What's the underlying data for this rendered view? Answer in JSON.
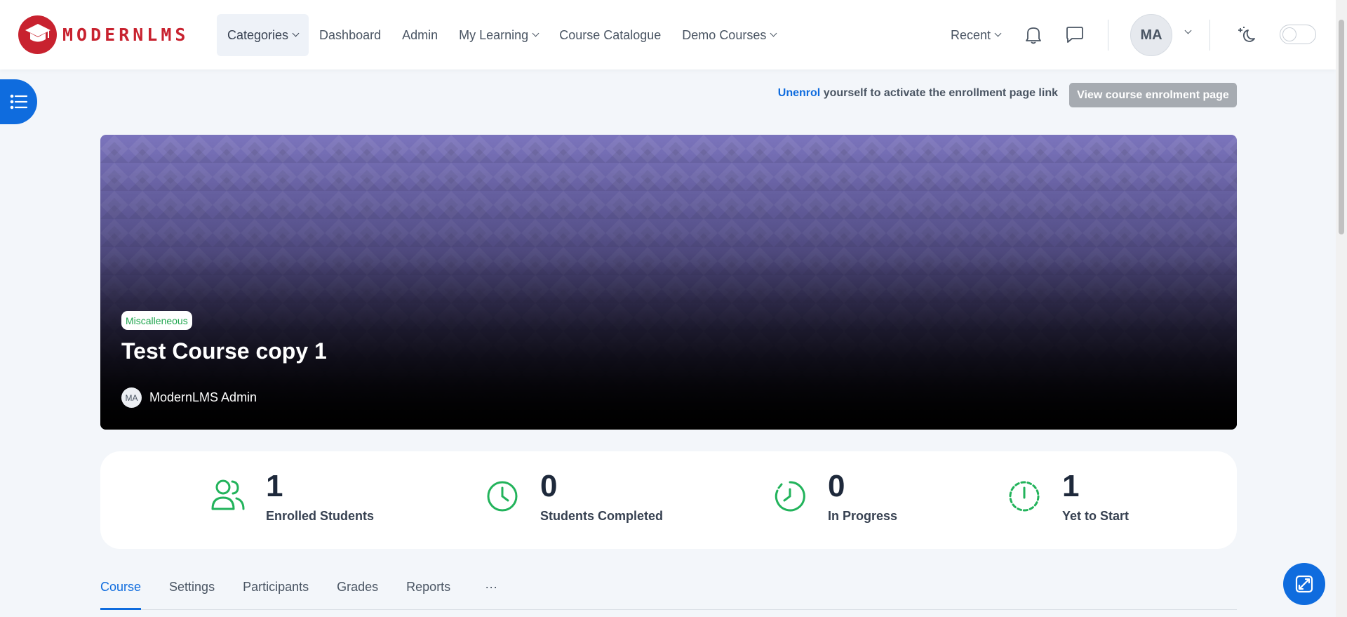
{
  "brand": {
    "name": "MODERNLMS",
    "color": "#c8222f"
  },
  "nav": {
    "categories": "Categories",
    "dashboard": "Dashboard",
    "admin": "Admin",
    "my_learning": "My Learning",
    "course_catalogue": "Course Catalogue",
    "demo_courses": "Demo Courses",
    "recent": "Recent",
    "user_initials": "MA"
  },
  "enrol": {
    "link_text": "Unenrol",
    "message": "yourself to activate the enrollment page link",
    "button": "View course enrolment page"
  },
  "course": {
    "category": "Miscalleneous",
    "title": "Test Course copy 1",
    "author_initials": "MA",
    "author_name": "ModernLMS Admin"
  },
  "stats": [
    {
      "value": "1",
      "label": "Enrolled Students",
      "icon": "users-icon"
    },
    {
      "value": "0",
      "label": "Students Completed",
      "icon": "clock-icon"
    },
    {
      "value": "0",
      "label": "In Progress",
      "icon": "progress-clock-icon"
    },
    {
      "value": "1",
      "label": "Yet to Start",
      "icon": "dashed-clock-icon"
    }
  ],
  "tabs": [
    "Course",
    "Settings",
    "Participants",
    "Grades",
    "Reports"
  ],
  "tabs_more": "···",
  "colors": {
    "accent": "#0f6cde",
    "success": "#1fa64e",
    "stat_icon": "#22b35b"
  }
}
